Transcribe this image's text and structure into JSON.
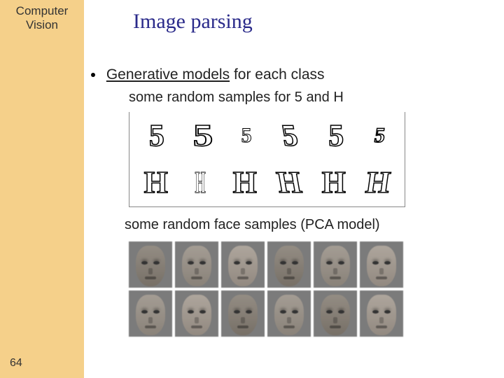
{
  "sidebar": {
    "line1": "Computer",
    "line2": "Vision"
  },
  "title": "Image parsing",
  "bullet": {
    "underlined": "Generative models",
    "rest": " for each class"
  },
  "sub1": "some random samples for 5 and H",
  "sub2": "some random face samples (PCA model)",
  "page_number": "64",
  "glyph_rows": {
    "fives": [
      "5",
      "5",
      "5",
      "5",
      "5",
      "5"
    ],
    "hs": [
      "H",
      "H",
      "H",
      "H",
      "H",
      "H"
    ]
  }
}
